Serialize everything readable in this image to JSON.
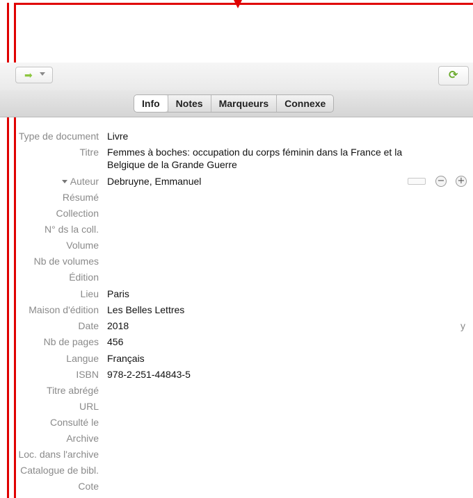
{
  "toolbar": {
    "nav_icon": "forward-arrow-icon",
    "sync_icon": "sync-icon"
  },
  "tabs": [
    {
      "label": "Info",
      "active": true
    },
    {
      "label": "Notes",
      "active": false
    },
    {
      "label": "Marqueurs",
      "active": false
    },
    {
      "label": "Connexe",
      "active": false
    }
  ],
  "fields": [
    {
      "label": "Type de document",
      "value": "Livre"
    },
    {
      "label": "Titre",
      "value": "Femmes à boches: occupation du corps féminin dans la France et la Belgique de la Grande Guerre"
    },
    {
      "label": "Auteur",
      "value": "Debruyne, Emmanuel"
    },
    {
      "label": "Résumé",
      "value": ""
    },
    {
      "label": "Collection",
      "value": ""
    },
    {
      "label": "N° ds la coll.",
      "value": ""
    },
    {
      "label": "Volume",
      "value": ""
    },
    {
      "label": "Nb de volumes",
      "value": ""
    },
    {
      "label": "Édition",
      "value": ""
    },
    {
      "label": "Lieu",
      "value": "Paris"
    },
    {
      "label": "Maison d'édition",
      "value": "Les Belles Lettres"
    },
    {
      "label": "Date",
      "value": "2018",
      "suffix": "y"
    },
    {
      "label": "Nb de pages",
      "value": "456"
    },
    {
      "label": "Langue",
      "value": "Français"
    },
    {
      "label": "ISBN",
      "value": "978-2-251-44843-5"
    },
    {
      "label": "Titre abrégé",
      "value": ""
    },
    {
      "label": "URL",
      "value": ""
    },
    {
      "label": "Consulté le",
      "value": ""
    },
    {
      "label": "Archive",
      "value": ""
    },
    {
      "label": "Loc. dans l'archive",
      "value": ""
    },
    {
      "label": "Catalogue de bibl.",
      "value": ""
    },
    {
      "label": "Cote",
      "value": ""
    }
  ],
  "creator_controls": {
    "remove_symbol": "−",
    "add_symbol": "+"
  },
  "colors": {
    "annotation_red": "#e00000",
    "label_gray": "#8a8a8a",
    "sync_green": "#6aaa2c"
  }
}
